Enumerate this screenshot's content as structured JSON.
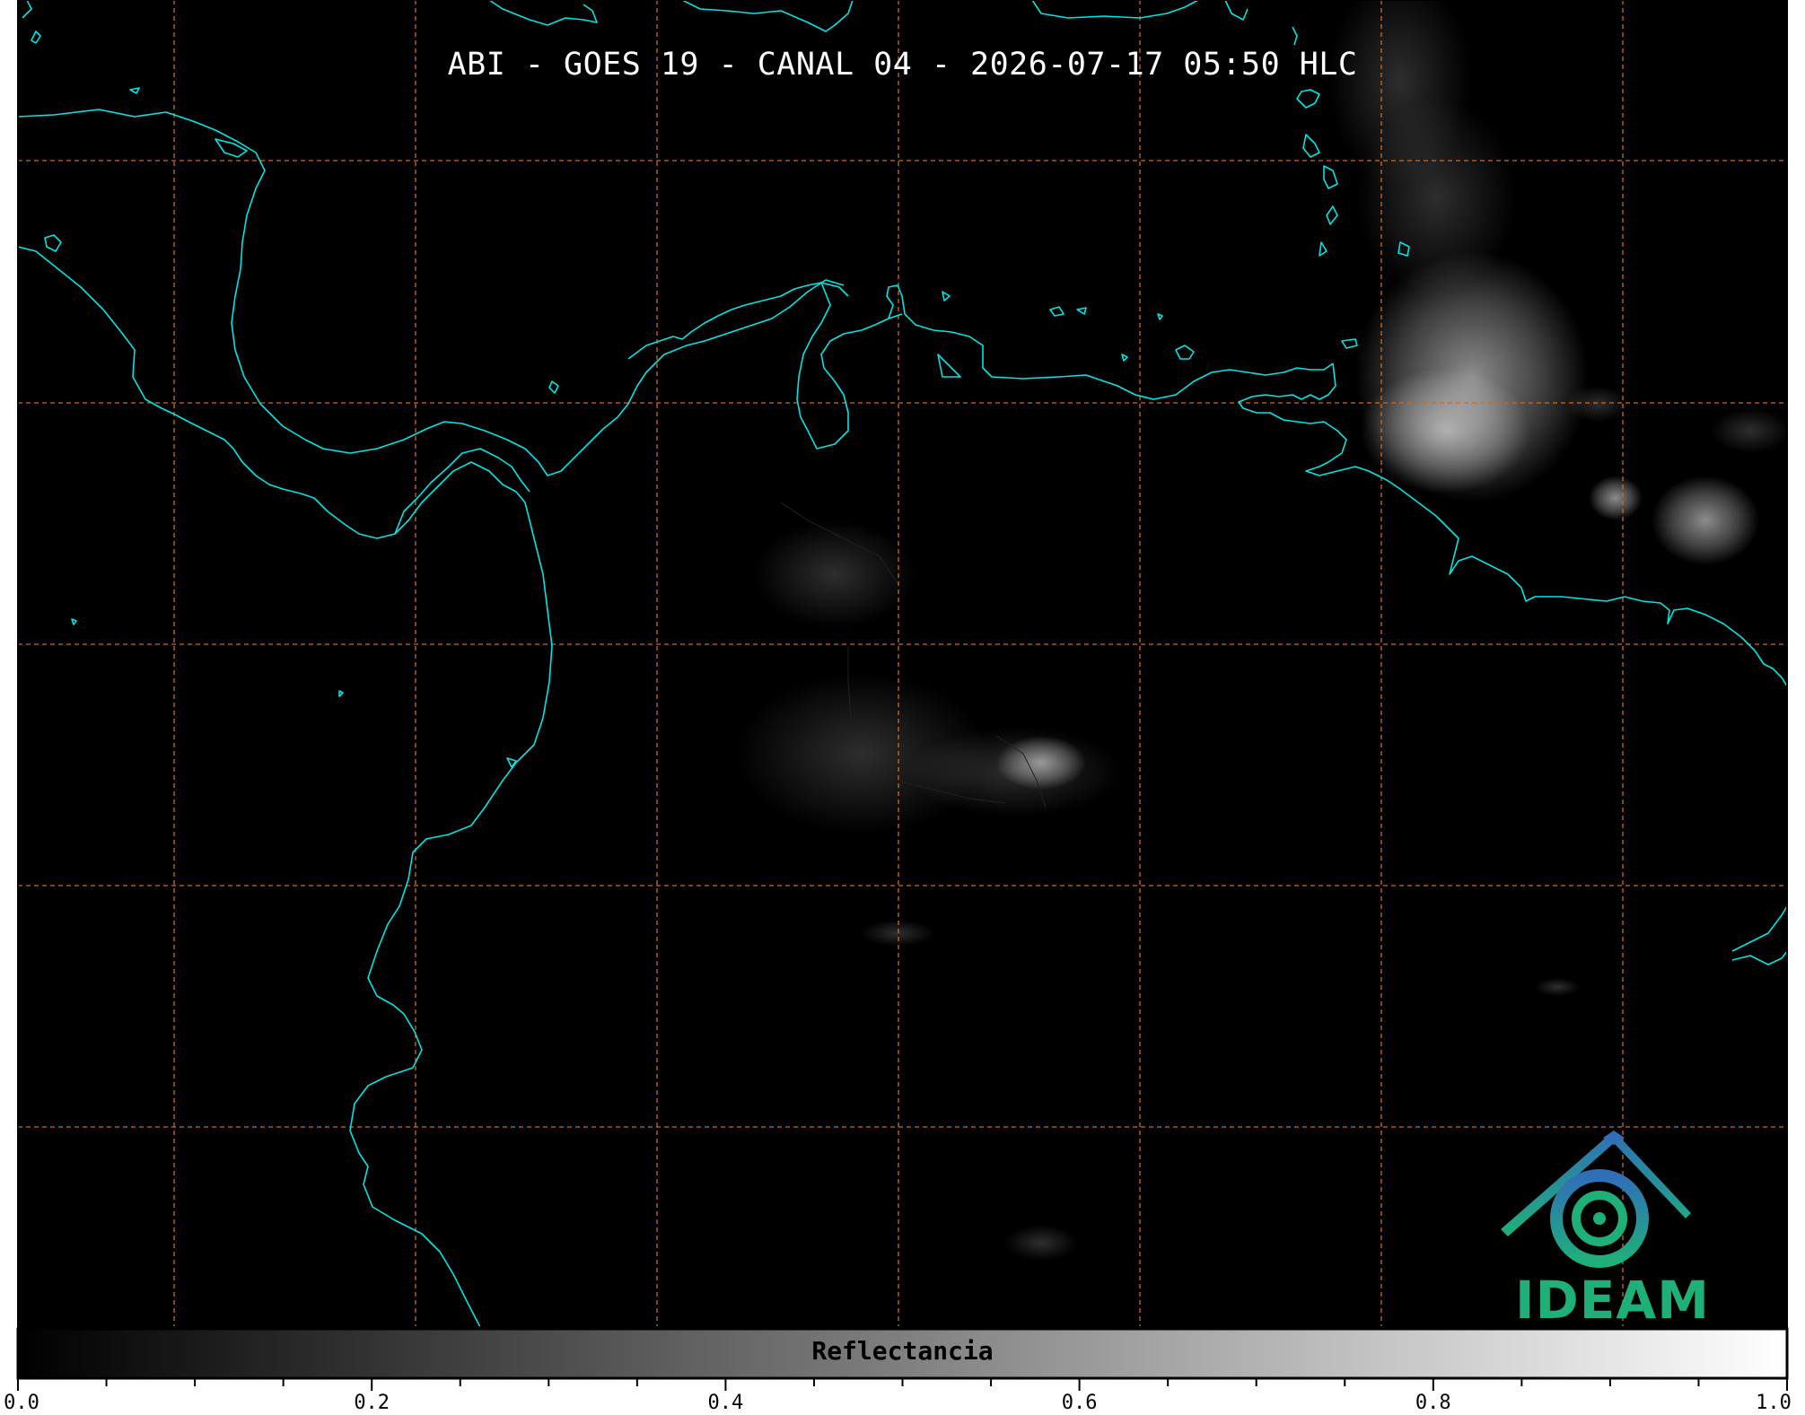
{
  "title": "ABI - GOES 19 - CANAL 04 - 2026-07-17 05:50 HLC",
  "colors": {
    "background": "#000000",
    "coastline": "#00e5e5",
    "graticule": "#d2691e",
    "title_text": "#ffffff",
    "cloud": "#ffffff",
    "logo_blue": "#2f6fb8",
    "logo_green": "#1fb07a"
  },
  "logo": {
    "text": "IDEAM",
    "icon": "ideam-mountain-spiral-icon"
  },
  "colorbar": {
    "label": "Reflectancia",
    "min": 0.0,
    "max": 1.0,
    "colormap": "grayscale",
    "ticks": [
      "0.0",
      "0.2",
      "0.4",
      "0.6",
      "0.8",
      "1.0"
    ],
    "tick_values": [
      0.0,
      0.2,
      0.4,
      0.6,
      0.8,
      1.0
    ],
    "minor_step": 0.05
  },
  "graticule": {
    "style": "dashed",
    "vertical_lines": 7,
    "horizontal_lines": 5
  }
}
